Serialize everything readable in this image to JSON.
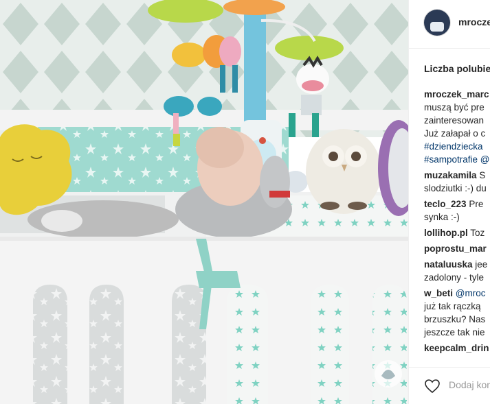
{
  "post": {
    "username": "mroczek_marc",
    "likes_label": "Liczba polubie"
  },
  "comments": [
    {
      "author": "mroczek_marc",
      "lines": [
        "muszą być pre",
        "zainteresowan",
        "Już załapał o c"
      ],
      "tags": [
        "#dziendziecka",
        "#sampotrafie @"
      ]
    },
    {
      "author": "muzakamila",
      "lines": [
        "S",
        "slodziutki :-) du"
      ]
    },
    {
      "author": "teclo_223",
      "lines": [
        "Pre",
        "synka :-)"
      ]
    },
    {
      "author": "lollihop.pl",
      "lines": [
        "Toz"
      ]
    },
    {
      "author": "poprostu_mar",
      "lines": [
        ""
      ]
    },
    {
      "author": "nataluuska",
      "lines": [
        "jee",
        "zadolony - tyle"
      ]
    },
    {
      "author": "w_beti",
      "lines": [
        "@mroc",
        "już tak rączką",
        "brzuszku? Nas",
        "jeszcze tak nie"
      ]
    },
    {
      "author": "keepcalm_drin",
      "lines": [
        ""
      ]
    }
  ],
  "footer": {
    "add_comment": "Dodaj kon"
  },
  "icons": {
    "heart": "heart-icon",
    "avatar": "avatar"
  },
  "colors": {
    "wall": "#e4ebe7",
    "wall_diamond": "#c9d8d2",
    "bumper_mint": "#9ed8cf",
    "crib": "#f2f2f2",
    "tag": "#003569"
  }
}
